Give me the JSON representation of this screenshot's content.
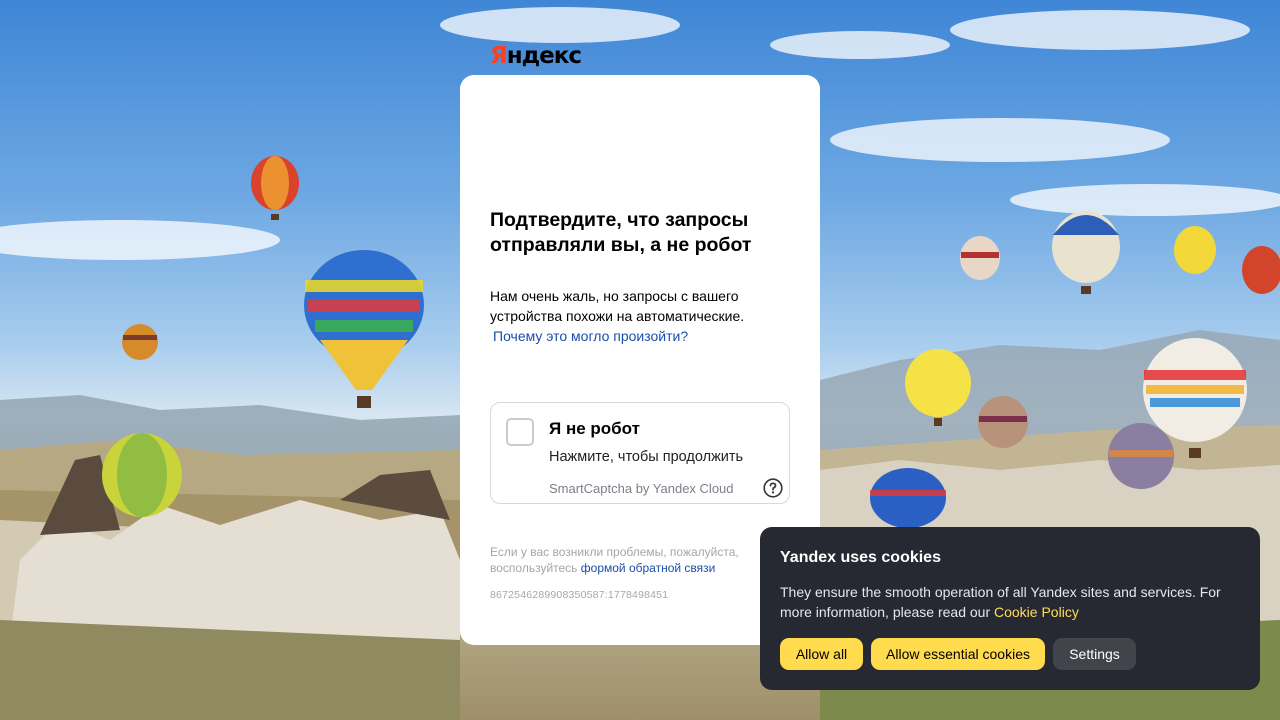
{
  "captcha": {
    "logo_first": "Я",
    "logo_rest": "ндекс",
    "title": "Подтвердите, что запросы отправляли вы, а не робот",
    "description": "Нам очень жаль, но запросы с вашего устройства похожи на автоматические.",
    "why_link": "Почему это могло произойти?",
    "checkbox_label": "Я не робот",
    "checkbox_sub": "Нажмите, чтобы продолжить",
    "brand": "SmartCaptcha by Yandex Cloud",
    "feedback_text": "Если у вас возникли проблемы, пожалуйста, воспользуйтесь",
    "feedback_link": "формой обратной связи",
    "request_id": "8672546289908350587:1778498451"
  },
  "cookie_banner": {
    "title": "Yandex uses cookies",
    "text": "They ensure the smooth operation of all Yandex sites and services. For more information, please read our",
    "policy_link": "Cookie Policy",
    "allow_all": "Allow all",
    "allow_essential": "Allow essential cookies",
    "settings": "Settings"
  },
  "colors": {
    "brand_red": "#fc3f1d",
    "link_blue": "#1a4fa8",
    "cookie_bg": "#272932",
    "cookie_accent": "#ffdb4d"
  },
  "icons": [
    "help-icon",
    "hot-air-balloon"
  ]
}
